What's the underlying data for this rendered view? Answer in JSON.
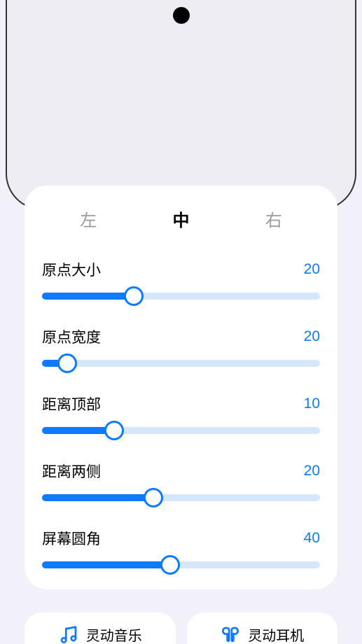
{
  "tabs": {
    "left": "左",
    "center": "中",
    "right": "右"
  },
  "sliders": [
    {
      "label": "原点大小",
      "value": "20",
      "fillPercent": 33
    },
    {
      "label": "原点宽度",
      "value": "20",
      "fillPercent": 9
    },
    {
      "label": "距离顶部",
      "value": "10",
      "fillPercent": 26
    },
    {
      "label": "距离两侧",
      "value": "20",
      "fillPercent": 40
    },
    {
      "label": "屏幕圆角",
      "value": "40",
      "fillPercent": 46
    }
  ],
  "bottomOptions": {
    "music": "灵动音乐",
    "earbuds": "灵动耳机"
  },
  "colors": {
    "accent": "#0d7aff"
  }
}
